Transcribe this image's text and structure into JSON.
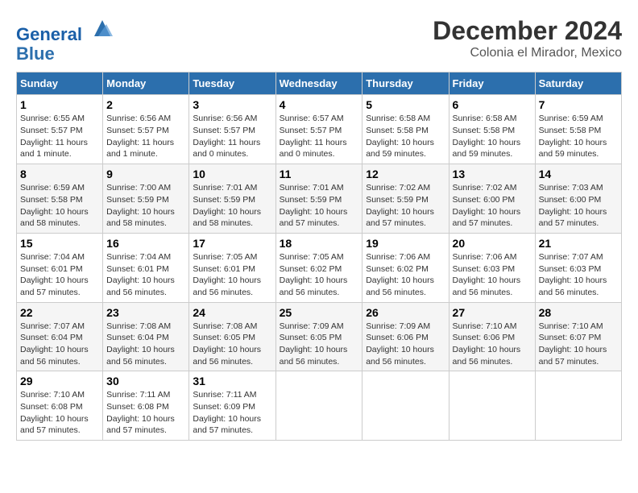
{
  "header": {
    "logo_line1": "General",
    "logo_line2": "Blue",
    "month": "December 2024",
    "location": "Colonia el Mirador, Mexico"
  },
  "weekdays": [
    "Sunday",
    "Monday",
    "Tuesday",
    "Wednesday",
    "Thursday",
    "Friday",
    "Saturday"
  ],
  "weeks": [
    [
      {
        "day": "1",
        "sunrise": "6:55 AM",
        "sunset": "5:57 PM",
        "daylight": "11 hours and 1 minute."
      },
      {
        "day": "2",
        "sunrise": "6:56 AM",
        "sunset": "5:57 PM",
        "daylight": "11 hours and 1 minute."
      },
      {
        "day": "3",
        "sunrise": "6:56 AM",
        "sunset": "5:57 PM",
        "daylight": "11 hours and 0 minutes."
      },
      {
        "day": "4",
        "sunrise": "6:57 AM",
        "sunset": "5:57 PM",
        "daylight": "11 hours and 0 minutes."
      },
      {
        "day": "5",
        "sunrise": "6:58 AM",
        "sunset": "5:58 PM",
        "daylight": "10 hours and 59 minutes."
      },
      {
        "day": "6",
        "sunrise": "6:58 AM",
        "sunset": "5:58 PM",
        "daylight": "10 hours and 59 minutes."
      },
      {
        "day": "7",
        "sunrise": "6:59 AM",
        "sunset": "5:58 PM",
        "daylight": "10 hours and 59 minutes."
      }
    ],
    [
      {
        "day": "8",
        "sunrise": "6:59 AM",
        "sunset": "5:58 PM",
        "daylight": "10 hours and 58 minutes."
      },
      {
        "day": "9",
        "sunrise": "7:00 AM",
        "sunset": "5:59 PM",
        "daylight": "10 hours and 58 minutes."
      },
      {
        "day": "10",
        "sunrise": "7:01 AM",
        "sunset": "5:59 PM",
        "daylight": "10 hours and 58 minutes."
      },
      {
        "day": "11",
        "sunrise": "7:01 AM",
        "sunset": "5:59 PM",
        "daylight": "10 hours and 57 minutes."
      },
      {
        "day": "12",
        "sunrise": "7:02 AM",
        "sunset": "5:59 PM",
        "daylight": "10 hours and 57 minutes."
      },
      {
        "day": "13",
        "sunrise": "7:02 AM",
        "sunset": "6:00 PM",
        "daylight": "10 hours and 57 minutes."
      },
      {
        "day": "14",
        "sunrise": "7:03 AM",
        "sunset": "6:00 PM",
        "daylight": "10 hours and 57 minutes."
      }
    ],
    [
      {
        "day": "15",
        "sunrise": "7:04 AM",
        "sunset": "6:01 PM",
        "daylight": "10 hours and 57 minutes."
      },
      {
        "day": "16",
        "sunrise": "7:04 AM",
        "sunset": "6:01 PM",
        "daylight": "10 hours and 56 minutes."
      },
      {
        "day": "17",
        "sunrise": "7:05 AM",
        "sunset": "6:01 PM",
        "daylight": "10 hours and 56 minutes."
      },
      {
        "day": "18",
        "sunrise": "7:05 AM",
        "sunset": "6:02 PM",
        "daylight": "10 hours and 56 minutes."
      },
      {
        "day": "19",
        "sunrise": "7:06 AM",
        "sunset": "6:02 PM",
        "daylight": "10 hours and 56 minutes."
      },
      {
        "day": "20",
        "sunrise": "7:06 AM",
        "sunset": "6:03 PM",
        "daylight": "10 hours and 56 minutes."
      },
      {
        "day": "21",
        "sunrise": "7:07 AM",
        "sunset": "6:03 PM",
        "daylight": "10 hours and 56 minutes."
      }
    ],
    [
      {
        "day": "22",
        "sunrise": "7:07 AM",
        "sunset": "6:04 PM",
        "daylight": "10 hours and 56 minutes."
      },
      {
        "day": "23",
        "sunrise": "7:08 AM",
        "sunset": "6:04 PM",
        "daylight": "10 hours and 56 minutes."
      },
      {
        "day": "24",
        "sunrise": "7:08 AM",
        "sunset": "6:05 PM",
        "daylight": "10 hours and 56 minutes."
      },
      {
        "day": "25",
        "sunrise": "7:09 AM",
        "sunset": "6:05 PM",
        "daylight": "10 hours and 56 minutes."
      },
      {
        "day": "26",
        "sunrise": "7:09 AM",
        "sunset": "6:06 PM",
        "daylight": "10 hours and 56 minutes."
      },
      {
        "day": "27",
        "sunrise": "7:10 AM",
        "sunset": "6:06 PM",
        "daylight": "10 hours and 56 minutes."
      },
      {
        "day": "28",
        "sunrise": "7:10 AM",
        "sunset": "6:07 PM",
        "daylight": "10 hours and 57 minutes."
      }
    ],
    [
      {
        "day": "29",
        "sunrise": "7:10 AM",
        "sunset": "6:08 PM",
        "daylight": "10 hours and 57 minutes."
      },
      {
        "day": "30",
        "sunrise": "7:11 AM",
        "sunset": "6:08 PM",
        "daylight": "10 hours and 57 minutes."
      },
      {
        "day": "31",
        "sunrise": "7:11 AM",
        "sunset": "6:09 PM",
        "daylight": "10 hours and 57 minutes."
      },
      null,
      null,
      null,
      null
    ]
  ],
  "labels": {
    "sunrise": "Sunrise:",
    "sunset": "Sunset:",
    "daylight": "Daylight:"
  }
}
